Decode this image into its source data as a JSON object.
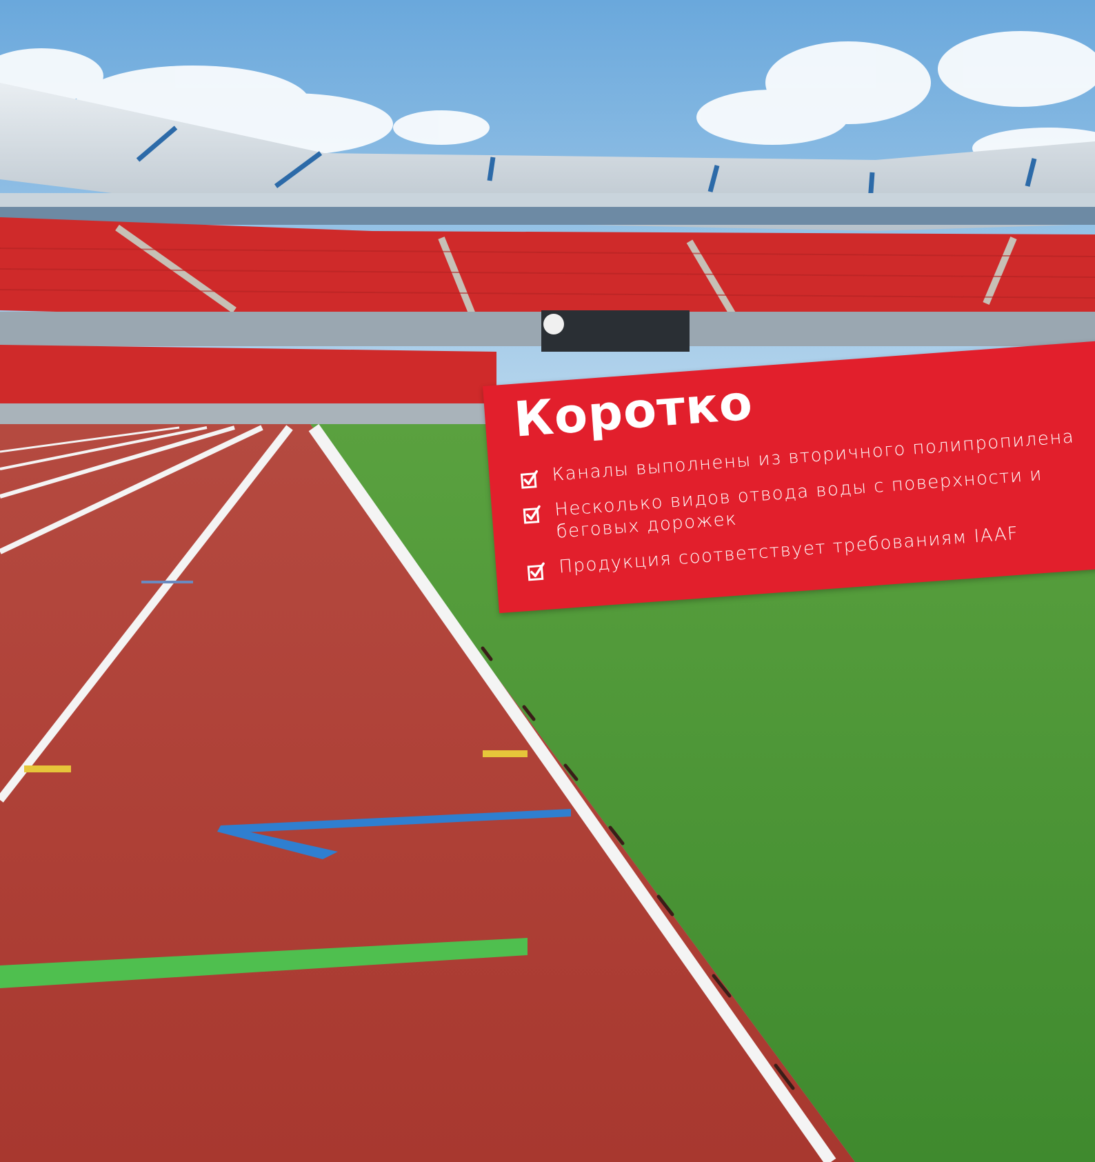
{
  "colors": {
    "accent_bar": "#f08a2c",
    "card_red": "#e21f2c",
    "sky": "#8ec0e4",
    "track": "#b8413a",
    "grass": "#4f9a3c",
    "seats": "#cf2a2a"
  },
  "card": {
    "title": "Коротко",
    "items": [
      {
        "text": "Каналы выполнены из вторичного полипропилена",
        "icon": "checkbox-checked-icon"
      },
      {
        "text": "Несколько видов отвода воды с поверхности и беговых дорожек",
        "icon": "checkbox-checked-icon"
      },
      {
        "text": "Продукция соответствует требованиям IAAF",
        "icon": "checkbox-checked-icon"
      }
    ]
  }
}
